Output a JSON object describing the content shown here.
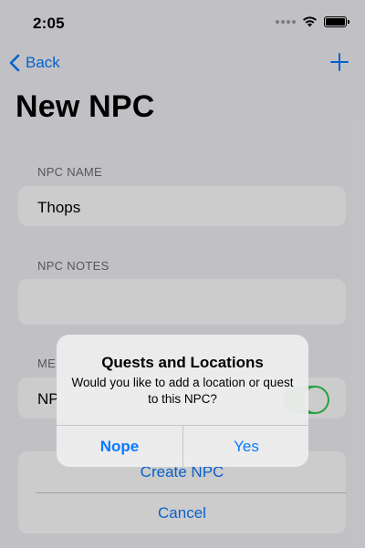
{
  "status_bar": {
    "time": "2:05"
  },
  "nav": {
    "back_label": "Back",
    "add_label": "+"
  },
  "page": {
    "title": "New NPC"
  },
  "form": {
    "npc_name": {
      "header": "NPC NAME",
      "value": "Thops"
    },
    "npc_notes": {
      "header": "NPC NOTES",
      "value": ""
    },
    "toggle_section": {
      "header": "ME",
      "label": "NP",
      "on": true
    }
  },
  "buttons": {
    "create_label": "Create NPC",
    "cancel_label": "Cancel"
  },
  "alert": {
    "title": "Quests and Locations",
    "message": "Would you like to add a location or quest to this NPC?",
    "nope_label": "Nope",
    "yes_label": "Yes"
  },
  "colors": {
    "accent": "#0a7aff",
    "toggle_on": "#34c759",
    "background": "#f2f2f7"
  }
}
